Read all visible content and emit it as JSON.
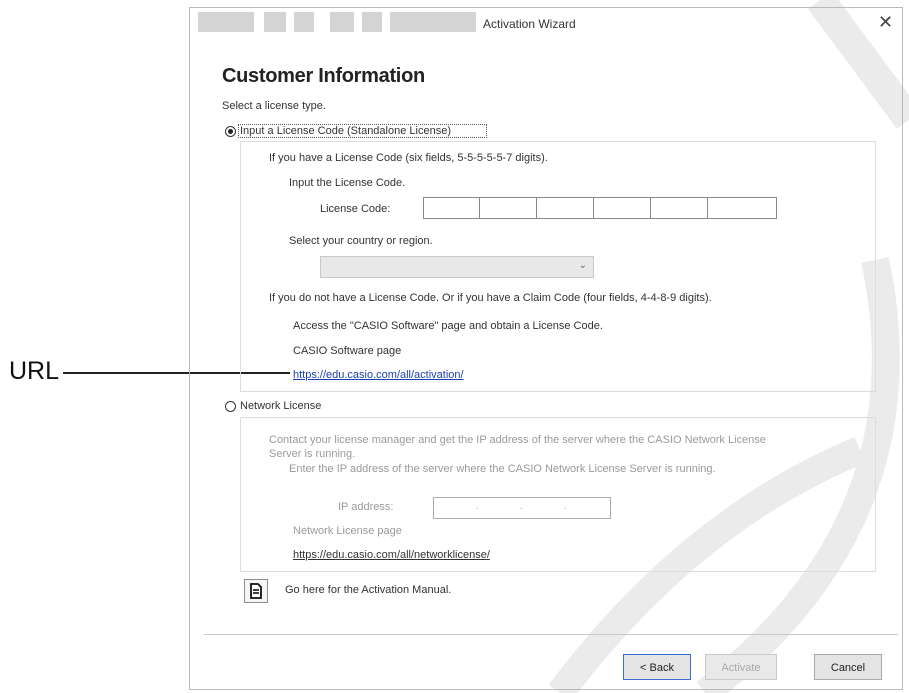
{
  "callout": {
    "label": "URL"
  },
  "window": {
    "title": "Activation Wizard",
    "close_glyph": "✕"
  },
  "page": {
    "heading": "Customer Information",
    "instruction": "Select a license type."
  },
  "standalone": {
    "radio_label": "Input a License Code (Standalone License)",
    "selected": true,
    "intro": "If you have a License Code (six fields, 5-5-5-5-5-7 digits).",
    "input_prompt": "Input the License Code.",
    "code_label": "License Code:",
    "code_fields": [
      "",
      "",
      "",
      "",
      "",
      ""
    ],
    "country_prompt": "Select your country or region.",
    "country_value": "",
    "no_code_text": "If you do not have a License Code. Or if you have a Claim Code (four fields, 4-4-8-9 digits).",
    "access_text": "Access the \"CASIO Software\" page and obtain a License Code.",
    "page_label": "CASIO Software page",
    "url": "https://edu.casio.com/all/activation/"
  },
  "network": {
    "radio_label": "Network License",
    "selected": false,
    "contact_line1": "Contact your license manager and get the IP address of the server where the CASIO Network License",
    "contact_line2": "Server is running.",
    "enter_ip_text": "Enter the IP address of the server where the CASIO Network License Server is running.",
    "ip_label": "IP address:",
    "ip_dots": [
      ".",
      ".",
      "."
    ],
    "page_label": "Network License page",
    "url": "https://edu.casio.com/all/networklicense/"
  },
  "manual": {
    "icon": "document-icon",
    "text": "Go here for the Activation Manual."
  },
  "buttons": {
    "back": "< Back",
    "activate": "Activate",
    "cancel": "Cancel"
  },
  "colors": {
    "link": "#1a3fb0",
    "watermark": "#ebebeb",
    "focus": "#3a6fd0"
  }
}
